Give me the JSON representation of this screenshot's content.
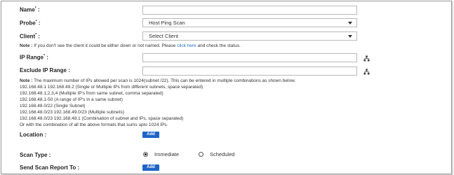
{
  "form": {
    "name": {
      "label": "Name",
      "required": "*",
      "colon": ":",
      "value": ""
    },
    "probe": {
      "label": "Probe",
      "required": "*",
      "colon": ":",
      "selected": "Host Ping Scan"
    },
    "client": {
      "label": "Client",
      "required": "*",
      "colon": ":",
      "selected": "Select Client"
    },
    "client_note": {
      "prefix": "Note :",
      "text": " If you don't see the client it could be either down or not named. Please ",
      "link": "click here",
      "suffix": " and check the status."
    },
    "ip_range": {
      "label": "IP Range",
      "required": "*",
      "colon": ":",
      "value": "",
      "icon": "network-icon"
    },
    "exclude_ip_range": {
      "label": "Exclude IP Range :",
      "value": "",
      "icon": "network-icon"
    },
    "ip_note": {
      "prefix": "Note :",
      "text": " The maximum number of IPs allowed per scan is 1024(subnet /22). This can be entered in multiple combinations as shown below.",
      "examples": [
        "192.168.48.1 192.168.49.2 (Single or Multiple IPs from different subnets, space separated)",
        "192.168.48.1,2,3,4 (Multiple IP's from same subnet, comma separated)",
        "192.168.48.1-50 (A range of IP's in a same subnet)",
        "192.168.48.0/22 (Single Subnet)",
        "192.168.48.0/23 192.168.49.0/23 (Multiple subnets)",
        "192.168.48.0/23 192.168.48.1 (Combination of subnet and IPs, space separated)",
        "Or with the combination of all the above formats that sums upto 1024 IPs."
      ]
    },
    "location": {
      "label": "Location :",
      "button": "Add"
    },
    "scan_type": {
      "label": "Scan Type :",
      "options": [
        {
          "label": "Immediate",
          "selected": true
        },
        {
          "label": "Scheduled",
          "selected": false
        }
      ]
    },
    "send_report": {
      "label": "Send Scan Report To :",
      "button": "Add"
    }
  },
  "colors": {
    "accent": "#1f63c6",
    "link": "#1a73c9"
  }
}
